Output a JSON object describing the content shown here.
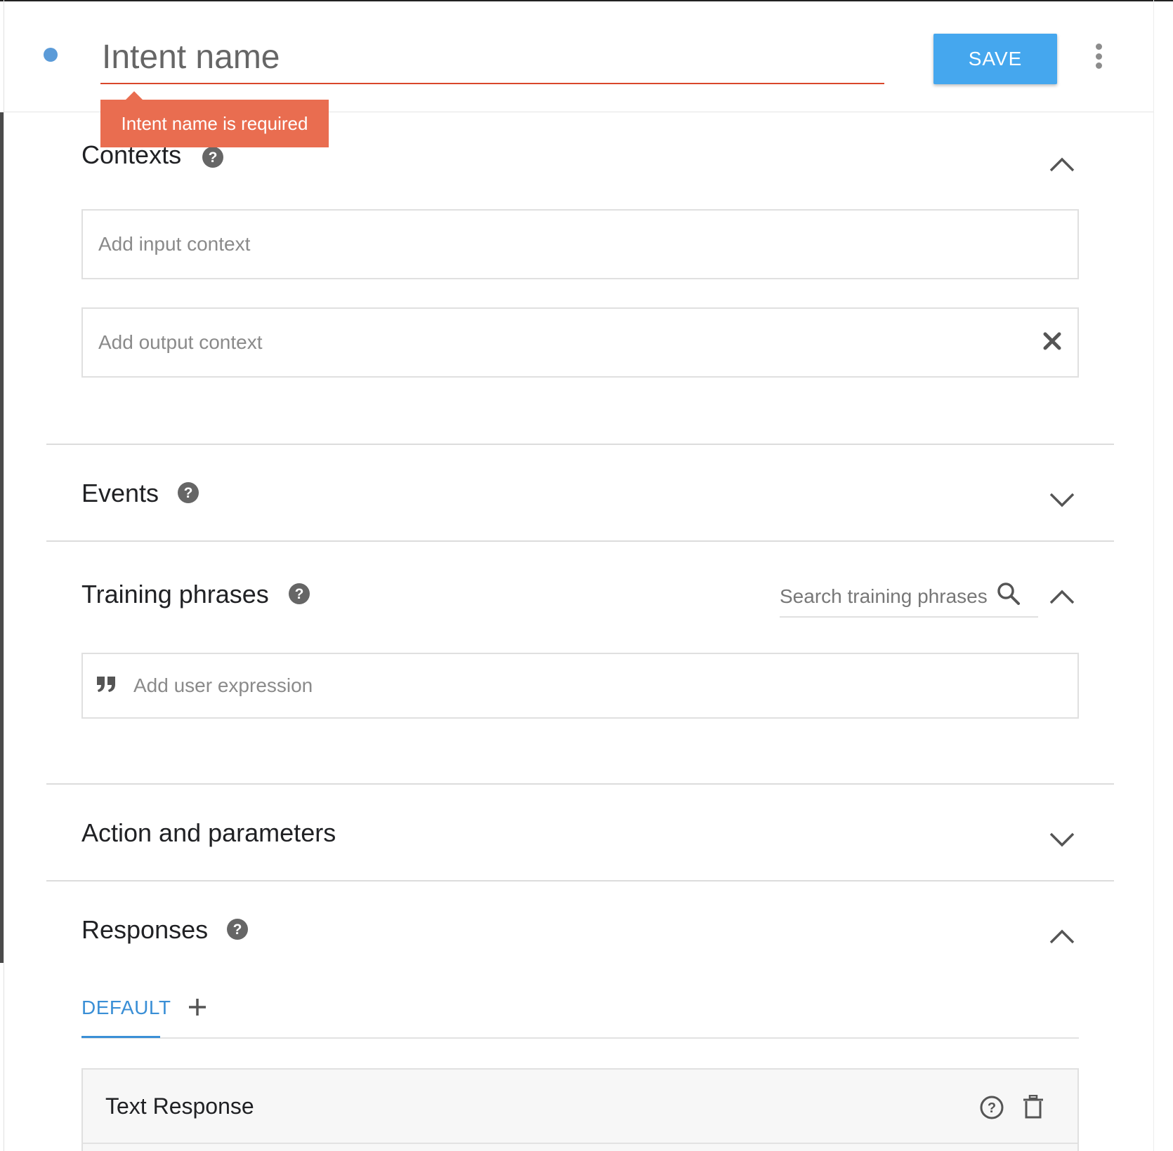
{
  "header": {
    "intent_placeholder": "Intent name",
    "save_label": "SAVE",
    "error_tooltip": "Intent name is required"
  },
  "contexts": {
    "title": "Contexts",
    "input_placeholder": "Add input context",
    "output_placeholder": "Add output context"
  },
  "events": {
    "title": "Events"
  },
  "training": {
    "title": "Training phrases",
    "search_placeholder": "Search training phrases",
    "expression_placeholder": "Add user expression"
  },
  "action": {
    "title": "Action and parameters"
  },
  "responses": {
    "title": "Responses",
    "tabs": [
      {
        "label": "DEFAULT"
      }
    ],
    "card_title": "Text Response"
  },
  "colors": {
    "accent": "#45a7ee",
    "error": "#e96d50",
    "underline_error": "#d9472b",
    "tab_active": "#3a8fd6"
  }
}
